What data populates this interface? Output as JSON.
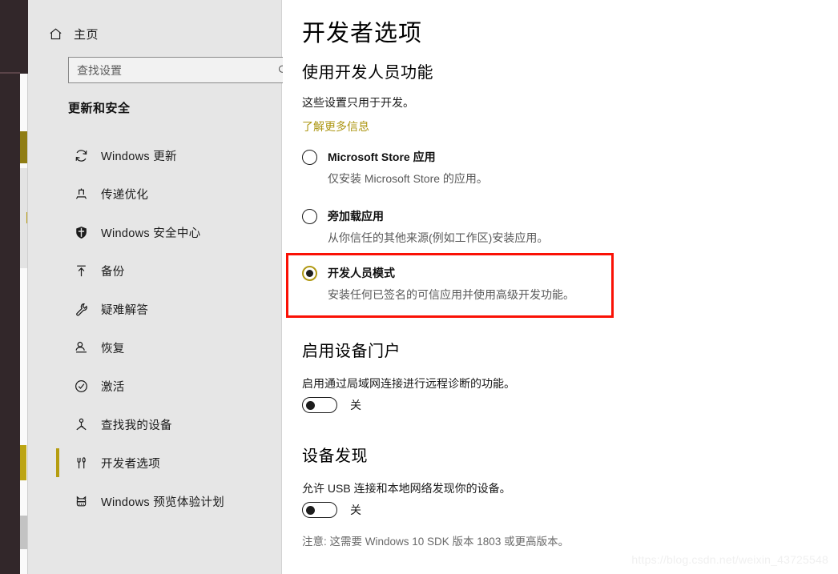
{
  "background": {
    "dark_strip_color": "#32272a",
    "accent_color": "#b59d10"
  },
  "sidebar": {
    "home": {
      "label": "主页",
      "icon": "home-icon"
    },
    "search": {
      "placeholder": "查找设置",
      "value": "",
      "icon": "search-icon"
    },
    "category_title": "更新和安全",
    "items": [
      {
        "label": "Windows 更新",
        "icon": "sync-refresh-icon",
        "active": false
      },
      {
        "label": "传递优化",
        "icon": "delivery-optimization-icon",
        "active": false
      },
      {
        "label": "Windows 安全中心",
        "icon": "shield-icon",
        "active": false
      },
      {
        "label": "备份",
        "icon": "backup-upload-icon",
        "active": false
      },
      {
        "label": "疑难解答",
        "icon": "wrench-icon",
        "active": false
      },
      {
        "label": "恢复",
        "icon": "recovery-icon",
        "active": false
      },
      {
        "label": "激活",
        "icon": "check-circle-icon",
        "active": false
      },
      {
        "label": "查找我的设备",
        "icon": "find-my-device-icon",
        "active": false
      },
      {
        "label": "开发者选项",
        "icon": "developer-tools-icon",
        "active": true
      },
      {
        "label": "Windows 预览体验计划",
        "icon": "insider-ninjacat-icon",
        "active": false
      }
    ]
  },
  "content": {
    "page_title": "开发者选项",
    "section_developer_features": {
      "heading": "使用开发人员功能",
      "description": "这些设置只用于开发。",
      "learn_more_link": "了解更多信息",
      "link_color": "#ac9612",
      "options": [
        {
          "label": "Microsoft Store 应用",
          "sublabel": "仅安装 Microsoft Store 的应用。",
          "selected": false
        },
        {
          "label": "旁加载应用",
          "sublabel": "从你信任的其他来源(例如工作区)安装应用。",
          "selected": false
        },
        {
          "label": "开发人员模式",
          "sublabel": "安装任何已签名的可信应用并使用高级开发功能。",
          "selected": true,
          "highlighted": true,
          "highlight_color": "#fa1105"
        }
      ]
    },
    "section_device_portal": {
      "heading": "启用设备门户",
      "description": "启用通过局域网连接进行远程诊断的功能。",
      "toggle": {
        "state": "off",
        "label": "关"
      }
    },
    "section_device_discovery": {
      "heading": "设备发现",
      "description": "允许 USB 连接和本地网络发现你的设备。",
      "toggle": {
        "state": "off",
        "label": "关"
      },
      "note": "注意: 这需要 Windows 10 SDK 版本 1803 或更高版本。"
    }
  },
  "watermark": "https://blog.csdn.net/weixin_43725548"
}
